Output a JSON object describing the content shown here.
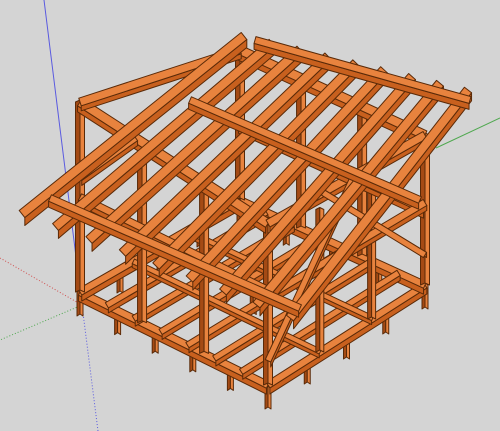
{
  "viewport": {
    "background": "#d4d4d4",
    "axes": {
      "red": "#d05050",
      "green": "#4fa84f",
      "blue": "#5a5ae0"
    }
  },
  "model": {
    "subject": "timber-frame-shed",
    "timber_colors": {
      "face_top": "#e8833e",
      "face_side": "#c8601e",
      "face_shade": "#a44a14",
      "edge": "#5a2a08"
    },
    "counts": {
      "rafters": 9,
      "posts_front": 4,
      "posts_back": 4,
      "floor_joists": 7,
      "piers": 18
    }
  }
}
